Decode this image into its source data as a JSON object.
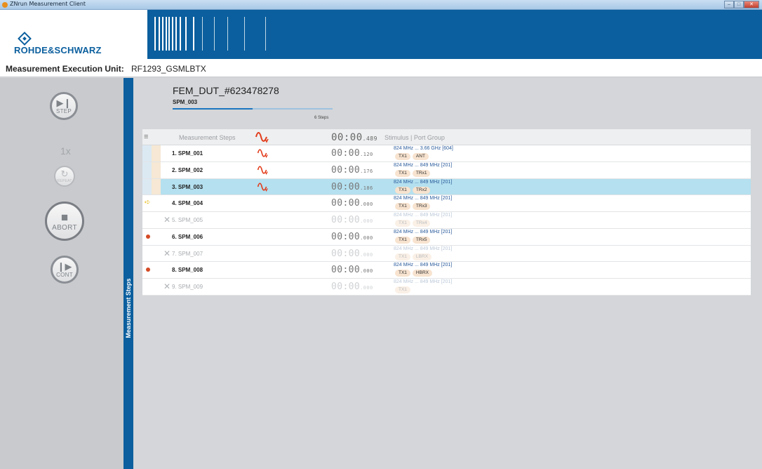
{
  "window": {
    "title": "ZNrun Measurement Client",
    "min": "‒",
    "max": "□",
    "close": "✕"
  },
  "header": {
    "brand": "ROHDE&SCHWARZ"
  },
  "subheader": {
    "label": "Measurement Execution Unit:",
    "value": "RF1293_GSMLBTX"
  },
  "controls": {
    "step": {
      "glyph": "▶❙",
      "label": "STEP"
    },
    "count": "1x",
    "repeat": {
      "glyph": "↻",
      "label": "REPEAT"
    },
    "abort": {
      "glyph": "■",
      "label": "ABORT"
    },
    "cont": {
      "glyph": "❙▶",
      "label": "CONT"
    }
  },
  "sidebar_tab": "Measurement Steps",
  "run": {
    "dut": "FEM_DUT_#623478278",
    "current_step": "SPM_003",
    "steps_count": "6 Steps",
    "progress": 0.5
  },
  "table": {
    "menu_icon": "≡",
    "headers": {
      "steps": "Measurement Steps",
      "time_main": "00:00",
      "time_ms": ".489",
      "stimulus": "Stimulus | Port Group"
    },
    "rows": [
      {
        "name": "1. SPM_001",
        "wave": true,
        "time": "00:00",
        "ms": ".120",
        "stim": "824 MHz ... 3.66 GHz [604]",
        "tags": [
          "TX1",
          "ANT"
        ],
        "status": "done"
      },
      {
        "name": "2. SPM_002",
        "wave": true,
        "time": "00:00",
        "ms": ".176",
        "stim": "824 MHz ... 849 MHz [201]",
        "tags": [
          "TX1",
          "TRx1"
        ],
        "status": "done"
      },
      {
        "name": "3. SPM_003",
        "wave": true,
        "time": "00:00",
        "ms": ".186",
        "stim": "824 MHz ... 849 MHz [201]",
        "tags": [
          "TX1",
          "TRx2"
        ],
        "status": "selected"
      },
      {
        "name": "4. SPM_004",
        "wave": false,
        "time": "00:00",
        "ms": ".000",
        "stim": "824 MHz ... 849 MHz [201]",
        "tags": [
          "TX1",
          "TRx3"
        ],
        "status": "next"
      },
      {
        "name": "5. SPM_005",
        "wave": false,
        "time": "00:00",
        "ms": ".000",
        "stim": "824 MHz ... 849 MHz [201]",
        "tags": [
          "TX1",
          "TRx4"
        ],
        "status": "skip"
      },
      {
        "name": "6. SPM_006",
        "wave": false,
        "time": "00:00",
        "ms": ".000",
        "stim": "824 MHz ... 849 MHz [201]",
        "tags": [
          "TX1",
          "TRx5"
        ],
        "status": "breakpoint"
      },
      {
        "name": "7. SPM_007",
        "wave": false,
        "time": "00:00",
        "ms": ".000",
        "stim": "824 MHz ... 849 MHz [201]",
        "tags": [
          "TX1",
          "LBRX"
        ],
        "status": "skip"
      },
      {
        "name": "8. SPM_008",
        "wave": false,
        "time": "00:00",
        "ms": ".000",
        "stim": "824 MHz ... 849 MHz [201]",
        "tags": [
          "TX1",
          "HBRX"
        ],
        "status": "breakpoint"
      },
      {
        "name": "9. SPM_009",
        "wave": false,
        "time": "00:00",
        "ms": ".000",
        "stim": "824 MHz ... 849 MHz [201]",
        "tags": [
          "TX1"
        ],
        "status": "skip"
      }
    ]
  },
  "colors": {
    "brand_blue": "#0b5f9e",
    "selected_row": "#b4e0ef",
    "wave_red": "#e23b1a",
    "breakpoint": "#d44a25",
    "next_arrow": "#e6b80c"
  }
}
